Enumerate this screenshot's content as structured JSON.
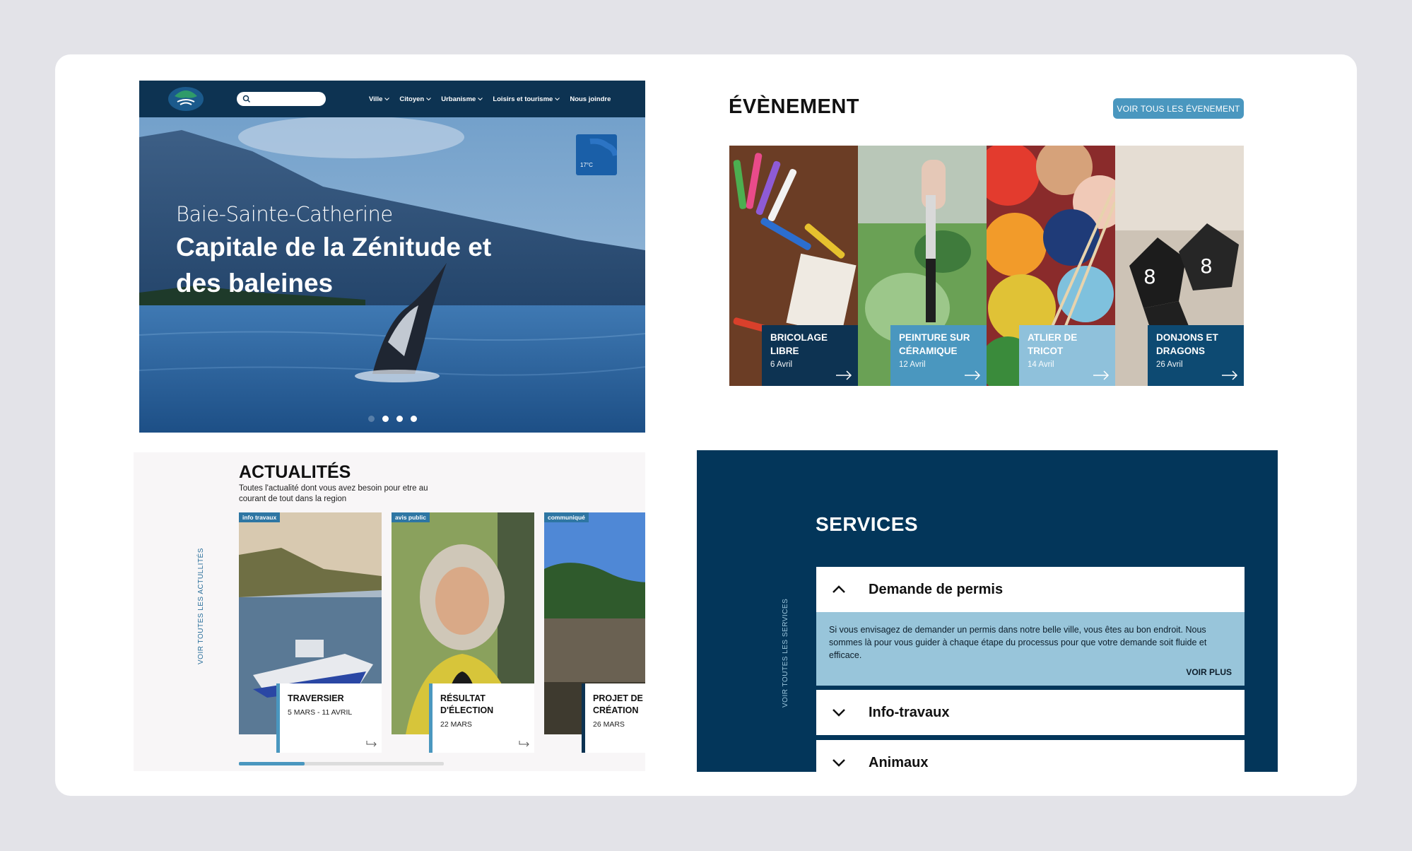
{
  "hero": {
    "nav": {
      "menu": [
        "Ville",
        "Citoyen",
        "Urbanisme",
        "Loisirs et tourisme",
        "Nous joindre"
      ]
    },
    "weather": "17°C",
    "town": "Baie-Sainte-Catherine",
    "title": "Capitale de la Zénitude et des baleines",
    "slides": 4,
    "active_slide": 1
  },
  "events": {
    "title": "ÉVÈNEMENT",
    "see_all": "VOIR TOUS LES ÉVENEMENT",
    "items": [
      {
        "name": "BRICOLAGE LIBRE",
        "date": "6 Avril",
        "color": "#0d3352"
      },
      {
        "name": "PEINTURE SUR CÉRAMIQUE",
        "date": "12 Avril",
        "color": "#4a97bf"
      },
      {
        "name": "ATLIER DE TRICOT",
        "date": "14 Avril",
        "color": "#8fc1db"
      },
      {
        "name": "DONJONS ET DRAGONS",
        "date": "26 Avril",
        "color": "#0d4a72"
      }
    ]
  },
  "news": {
    "title": "ACTUALITÉS",
    "subtitle": "Toutes l'actualité dont vous avez besoin pour etre au courant de tout dans la region",
    "side_link": "VOIR TOUTES LES ACTULLITÉS",
    "items": [
      {
        "tag": "info travaux",
        "title": "TRAVERSIER",
        "date": "5 MARS - 11 AVRIL"
      },
      {
        "tag": "avis public",
        "title": "RÉSULTAT D'ÉLECTION",
        "date": "22 MARS"
      },
      {
        "tag": "communiqué",
        "title": "PROJET DE CRÉATION",
        "date": "26 MARS"
      }
    ],
    "scroll_progress": 0.32
  },
  "services": {
    "title": "SERVICES",
    "side_link": "VOIR TOUTES LES SERVICES",
    "items": [
      {
        "label": "Demande de permis",
        "expanded": true,
        "body": "Si vous envisagez de demander un permis dans notre belle ville, vous êtes au bon endroit. Nous sommes là pour vous guider à chaque étape du processus pour que votre demande soit fluide et efficace.",
        "more": "VOIR PLUS"
      },
      {
        "label": "Info-travaux",
        "expanded": false
      },
      {
        "label": "Animaux",
        "expanded": false
      }
    ]
  },
  "colors": {
    "navy": "#0d3352",
    "accent": "#4a97bf",
    "light_blue": "#98c5da",
    "services_bg": "#03365a"
  }
}
